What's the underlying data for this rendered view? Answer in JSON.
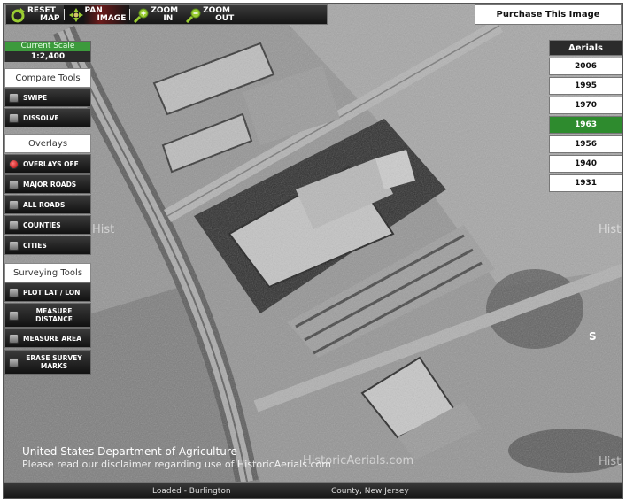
{
  "toolbar": {
    "reset": {
      "line1": "RESET",
      "line2": "MAP"
    },
    "pan": {
      "line1": "PAN",
      "line2": "IMAGE"
    },
    "zoom_in": {
      "line1": "ZOOM",
      "line2": "IN"
    },
    "zoom_out": {
      "line1": "ZOOM",
      "line2": "OUT"
    }
  },
  "purchase_label": "Purchase This Image",
  "scale": {
    "label": "Current Scale",
    "value": "1:2,400"
  },
  "compare": {
    "title": "Compare Tools",
    "swipe": "SWIPE",
    "dissolve": "DISSOLVE"
  },
  "overlays": {
    "title": "Overlays",
    "off": "OVERLAYS OFF",
    "major_roads": "MAJOR ROADS",
    "all_roads": "ALL ROADS",
    "counties": "COUNTIES",
    "cities": "CITIES"
  },
  "surveying": {
    "title": "Surveying Tools",
    "plot": "PLOT LAT / LON",
    "measure_distance": "MEASURE DISTANCE",
    "measure_area": "MEASURE AREA",
    "erase_marks": "ERASE SURVEY MARKS"
  },
  "aerials": {
    "title": "Aerials",
    "years": [
      "2006",
      "1995",
      "1970",
      "1963",
      "1956",
      "1940",
      "1931"
    ],
    "selected": "1963"
  },
  "watermarks": {
    "left": "Hist",
    "right": "Hist",
    "center": "HistoricAerials.com",
    "bottom_right": "Hist",
    "edge": "S"
  },
  "footer": {
    "agency": "United States Department of Agriculture",
    "disclaimer": "Please read our disclaimer regarding use of HistoricAerials.com"
  },
  "status": {
    "loaded": "Loaded - Burlington",
    "county": "County, New Jersey"
  },
  "colors": {
    "accent_green": "#2e8b2e",
    "toolbar_dark": "#151515"
  }
}
